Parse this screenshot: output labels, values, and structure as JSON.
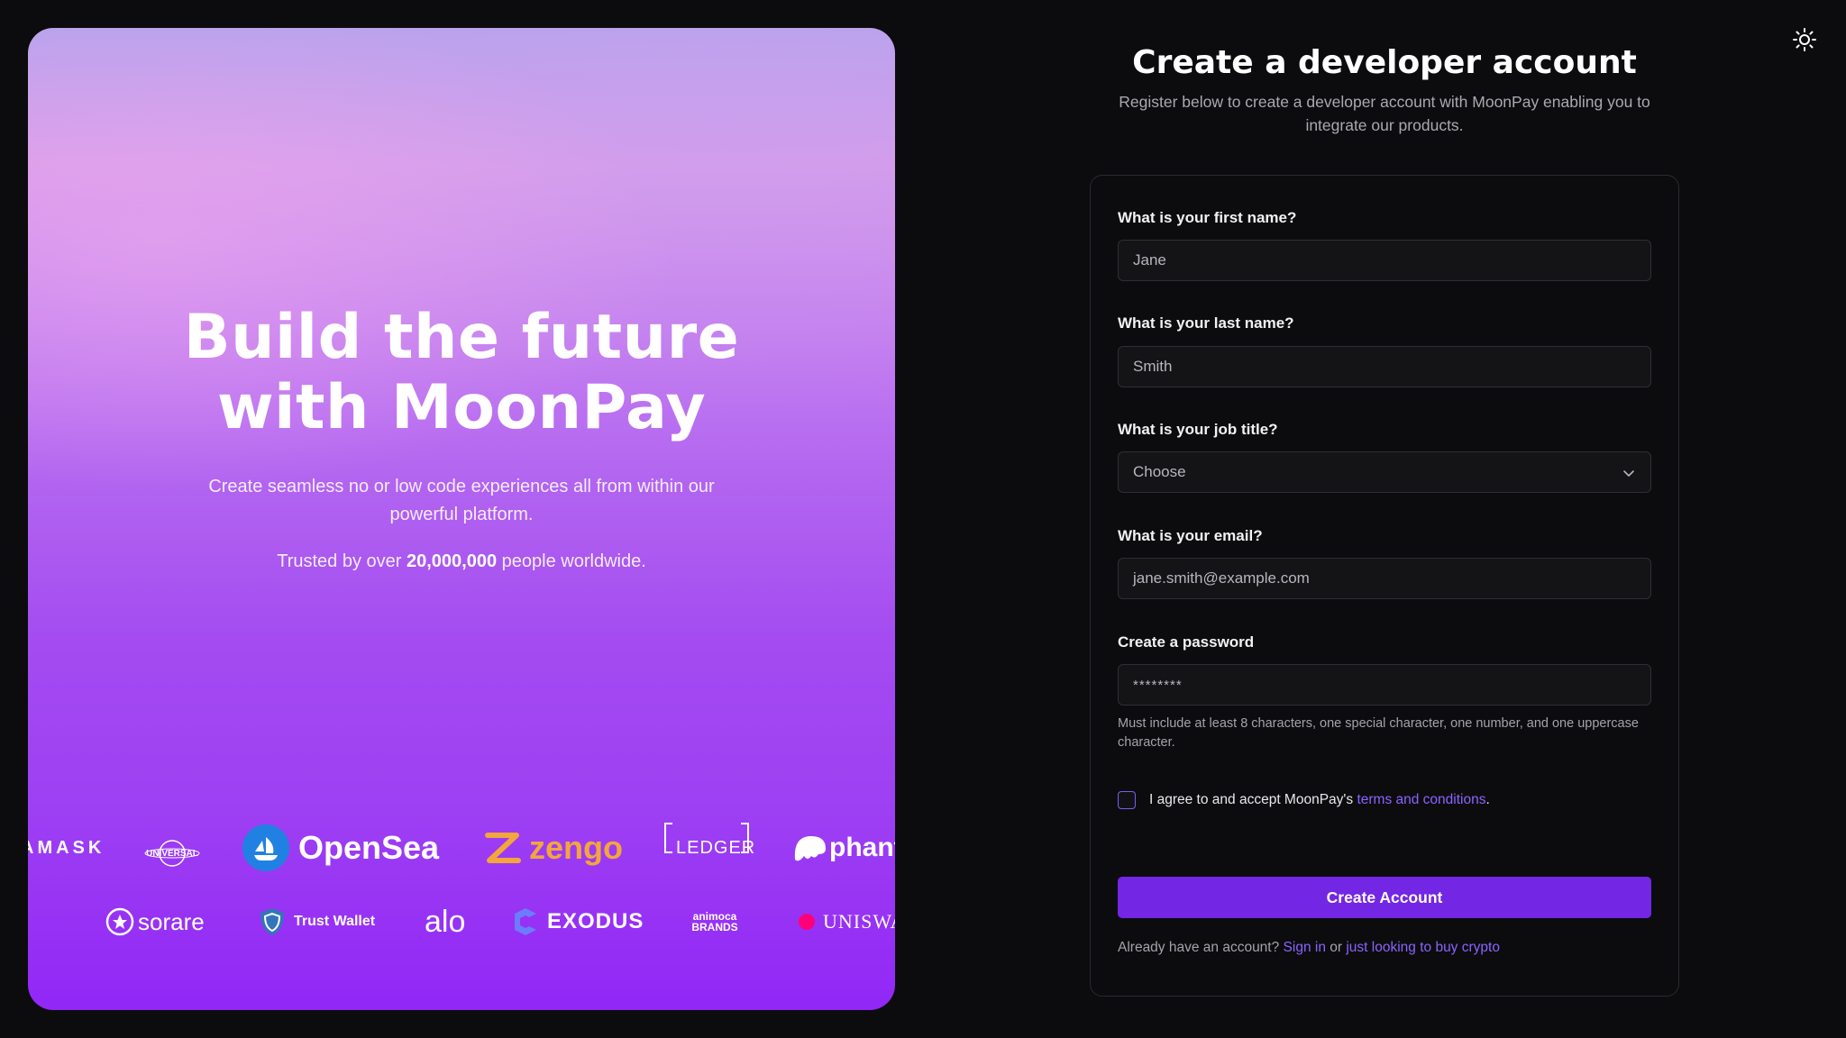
{
  "hero": {
    "title": "Build the future\nwith MoonPay",
    "subtitle": "Create seamless no or low code experiences all from within our powerful platform.",
    "trust_prefix": "Trusted by over ",
    "trust_count": "20,000,000",
    "trust_suffix": " people worldwide.",
    "partners_row1": [
      "AMASK",
      "UNIVERSAL",
      "OpenSea",
      "zengo",
      "LEDGER",
      "phant"
    ],
    "partners_row2": [
      "sorare",
      "Trust Wallet",
      "alo",
      "EXODUS",
      "animoca BRANDS",
      "UNISWA"
    ]
  },
  "form": {
    "title": "Create a developer account",
    "description": "Register below to create a developer account with MoonPay enabling you to integrate our products.",
    "first_name": {
      "label": "What is your first name?",
      "value": "Jane"
    },
    "last_name": {
      "label": "What is your last name?",
      "value": "Smith"
    },
    "job_title": {
      "label": "What is your job title?",
      "value": "Choose"
    },
    "email": {
      "label": "What is your email?",
      "value": "jane.smith@example.com"
    },
    "password": {
      "label": "Create a password",
      "value": "********",
      "hint": "Must include at least 8 characters, one special character, one number, and one uppercase character."
    },
    "agree_prefix": "I agree to and accept MoonPay's ",
    "agree_link": "terms and conditions",
    "agree_suffix": ".",
    "submit_label": "Create Account",
    "signin_prefix": "Already have an account? ",
    "signin_link": "Sign in",
    "signin_middle": " or ",
    "buy_link": "just looking to buy crypto"
  },
  "icons": {
    "theme_toggle": "sun-icon",
    "dropdown": "chevron-down-icon"
  },
  "colors": {
    "accent": "#7326e4",
    "link": "#8a63ff",
    "background": "#0c0c0e"
  }
}
